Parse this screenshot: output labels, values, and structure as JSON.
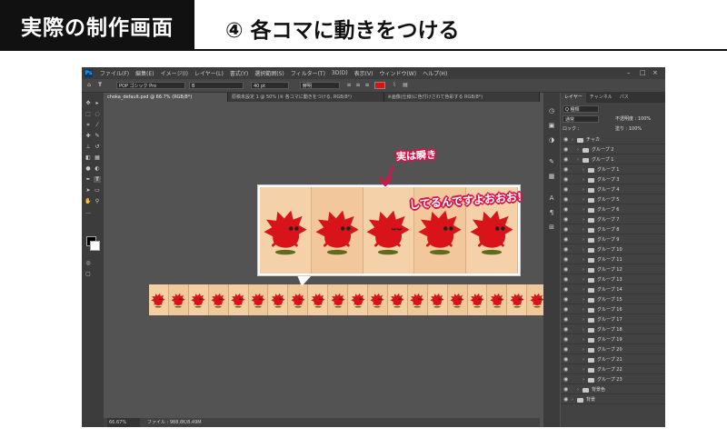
{
  "header": {
    "box_title": "実際の制作画面",
    "step_title": "④ 各コマに動きをつける"
  },
  "app": {
    "logo": "Ps",
    "menu": [
      "ファイル(F)",
      "編集(E)",
      "イメージ(I)",
      "レイヤー(L)",
      "書式(Y)",
      "選択範囲(S)",
      "フィルター(T)",
      "3D(D)",
      "表示(V)",
      "ウィンドウ(W)",
      "ヘルプ(H)"
    ],
    "options": {
      "font_family": "POP ゴシック Pro",
      "font_style": "B",
      "font_size": "40 pt",
      "aa": "鮮明",
      "text_color": "#e01010"
    },
    "tabs": [
      {
        "label": "choka_default.psd @ 66.7% (RGB/8*)",
        "active": true
      },
      {
        "label": "原稿未設定 1 @ 50% (④ 各コマに動きをつける, RGB/8*)",
        "active": false
      },
      {
        "label": "※画像(仕様)に色付けされて色彩する RGB/8*)",
        "active": false
      }
    ],
    "status": {
      "zoom": "66.67%",
      "doc": "ファイル : 988.8K/8.49M"
    },
    "layers_panel": {
      "tabs": [
        "レイヤー",
        "チャンネル",
        "パス"
      ],
      "filter": "Q 種類",
      "mode": "通常",
      "opacity_label": "不透明度 : 100%",
      "lock_label": "ロック :",
      "fill_label": "塗り : 100%",
      "rows": [
        {
          "name": "チャカ",
          "indent": 0
        },
        {
          "name": "グループ 2",
          "indent": 1
        },
        {
          "name": "グループ 1",
          "indent": 1
        },
        {
          "name": "グループ 1",
          "indent": 2
        },
        {
          "name": "グループ 3",
          "indent": 2
        },
        {
          "name": "グループ 4",
          "indent": 2
        },
        {
          "name": "グループ 5",
          "indent": 2
        },
        {
          "name": "グループ 6",
          "indent": 2
        },
        {
          "name": "グループ 7",
          "indent": 2
        },
        {
          "name": "グループ 8",
          "indent": 2
        },
        {
          "name": "グループ 9",
          "indent": 2
        },
        {
          "name": "グループ 10",
          "indent": 2
        },
        {
          "name": "グループ 11",
          "indent": 2
        },
        {
          "name": "グループ 12",
          "indent": 2
        },
        {
          "name": "グループ 13",
          "indent": 2
        },
        {
          "name": "グループ 14",
          "indent": 2
        },
        {
          "name": "グループ 15",
          "indent": 2
        },
        {
          "name": "グループ 16",
          "indent": 2
        },
        {
          "name": "グループ 17",
          "indent": 2
        },
        {
          "name": "グループ 18",
          "indent": 2
        },
        {
          "name": "グループ 19",
          "indent": 2
        },
        {
          "name": "グループ 20",
          "indent": 2
        },
        {
          "name": "グループ 21",
          "indent": 2
        },
        {
          "name": "グループ 22",
          "indent": 2
        },
        {
          "name": "グループ 23",
          "indent": 2
        },
        {
          "name": "背景色",
          "indent": 1
        },
        {
          "name": "背景",
          "indent": 0
        }
      ]
    }
  },
  "annotation": {
    "line1": "実は瞬き",
    "line2": "してるんですよおおお!"
  },
  "colors": {
    "annotation_outline": "#d8134a",
    "character_red": "#d8141a",
    "frame_bg": "#f2c79b"
  }
}
